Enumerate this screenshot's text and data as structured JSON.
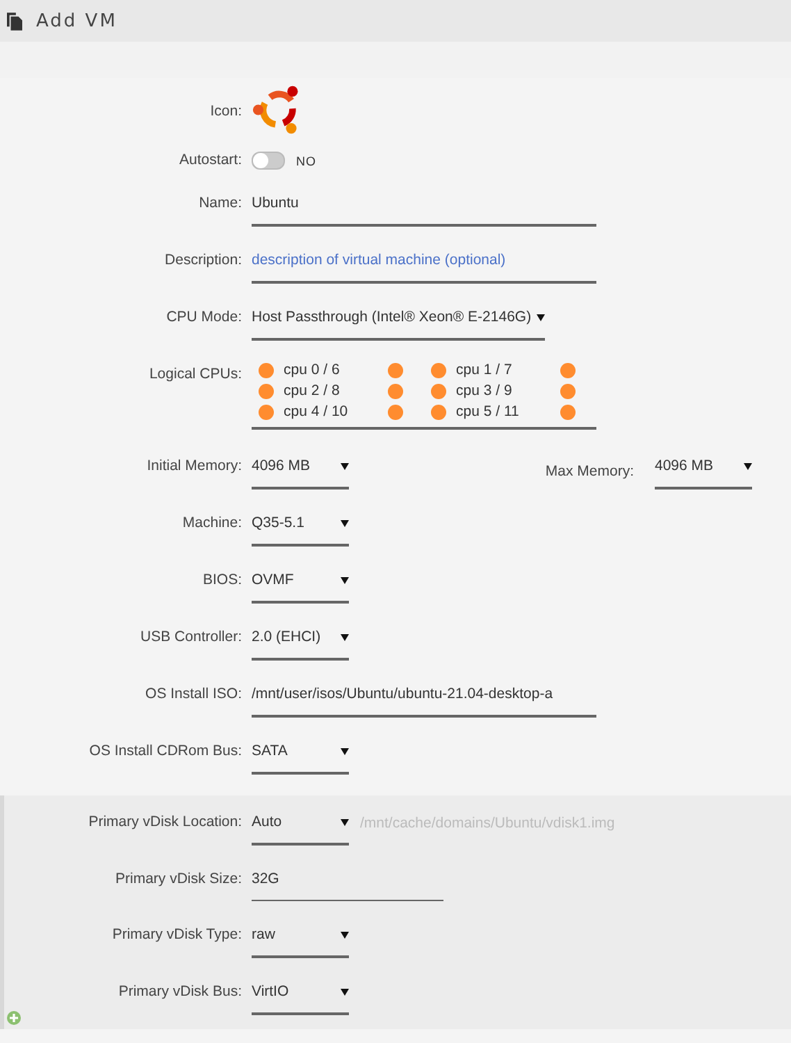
{
  "header": {
    "title": "Add VM"
  },
  "sections": [
    {
      "rows": [
        {
          "kind": "icon",
          "label": "Icon:"
        },
        {
          "kind": "toggle",
          "label": "Autostart:",
          "on": false,
          "state_text": "NO"
        },
        {
          "kind": "text",
          "label": "Name:",
          "value": "Ubuntu"
        },
        {
          "kind": "text",
          "label": "Description:",
          "placeholder": "description of virtual machine (optional)"
        },
        {
          "kind": "select",
          "label": "CPU Mode:",
          "value": "Host Passthrough (Intel® Xeon® E-2146G)"
        },
        {
          "kind": "cpus",
          "label": "Logical CPUs:",
          "cpus": [
            {
              "label": "cpu 0 / 6",
              "checked": false,
              "sibling_checked": false
            },
            {
              "label": "cpu 1 / 7",
              "checked": false,
              "sibling_checked": false
            },
            {
              "label": "cpu 2 / 8",
              "checked": false,
              "sibling_checked": false
            },
            {
              "label": "cpu 3 / 9",
              "checked": false,
              "sibling_checked": false
            },
            {
              "label": "cpu 4 / 10",
              "checked": false,
              "sibling_checked": false
            },
            {
              "label": "cpu 5 / 11",
              "checked": false,
              "sibling_checked": false
            }
          ]
        },
        {
          "kind": "memory",
          "label": "Initial Memory:",
          "value": "4096 MB",
          "max_label": "Max Memory:",
          "max_value": "4096 MB"
        },
        {
          "kind": "select",
          "label": "Machine:",
          "value": "Q35-5.1"
        },
        {
          "kind": "select",
          "label": "BIOS:",
          "value": "OVMF"
        },
        {
          "kind": "select",
          "label": "USB Controller:",
          "value": "2.0 (EHCI)"
        },
        {
          "kind": "text",
          "label": "OS Install ISO:",
          "value": "/mnt/user/isos/Ubuntu/ubuntu-21.04-desktop-a"
        },
        {
          "kind": "select",
          "label": "OS Install CDRom Bus:",
          "value": "SATA"
        }
      ]
    },
    {
      "rows": [
        {
          "kind": "select",
          "label": "Primary vDisk Location:",
          "value": "Auto",
          "note": "/mnt/cache/domains/Ubuntu/vdisk1.img"
        },
        {
          "kind": "text",
          "label": "Primary vDisk Size:",
          "value": "32G"
        },
        {
          "kind": "select",
          "label": "Primary vDisk Type:",
          "value": "raw"
        },
        {
          "kind": "select",
          "label": "Primary vDisk Bus:",
          "value": "VirtIO"
        }
      ]
    }
  ]
}
